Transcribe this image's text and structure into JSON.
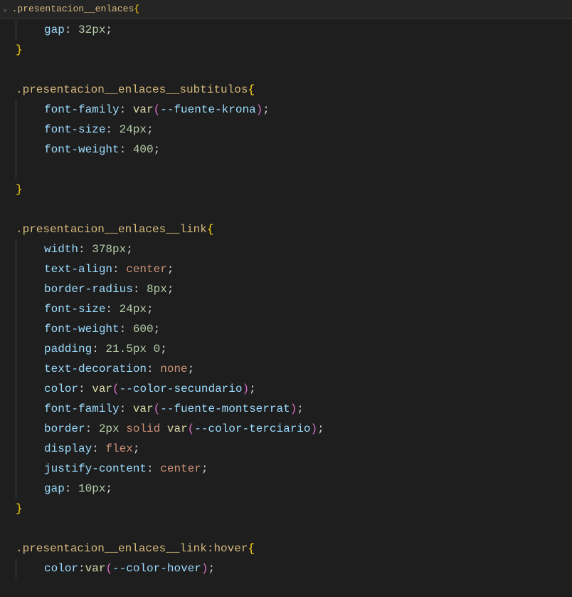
{
  "breadcrumb": {
    "selector": ".presentacion__enlaces"
  },
  "rules": [
    {
      "selector": ".presentacion__enlaces",
      "open_brace": "{",
      "decls": [
        {
          "prop": "gap",
          "value_num": "32px"
        }
      ],
      "close_brace": "}"
    },
    {
      "selector": ".presentacion__enlaces__subtitulos",
      "open_brace": "{",
      "decls": [
        {
          "prop": "font-family",
          "value_func": "var",
          "value_var": "--fuente-krona"
        },
        {
          "prop": "font-size",
          "value_num": "24px"
        },
        {
          "prop": "font-weight",
          "value_num": "400"
        }
      ],
      "trailing_blank": true,
      "close_brace": "}"
    },
    {
      "selector": ".presentacion__enlaces__link",
      "open_brace": "{",
      "decls": [
        {
          "prop": "width",
          "value_num": "378px"
        },
        {
          "prop": "text-align",
          "value_kw": "center"
        },
        {
          "prop": "border-radius",
          "value_num": "8px"
        },
        {
          "prop": "font-size",
          "value_num": "24px"
        },
        {
          "prop": "font-weight",
          "value_num": "600"
        },
        {
          "prop": "padding",
          "value_num": "21.5px 0"
        },
        {
          "prop": "text-decoration",
          "value_kw": "none"
        },
        {
          "prop": "color",
          "value_func": "var",
          "value_var": "--color-secundario"
        },
        {
          "prop": "font-family",
          "value_func": "var",
          "value_var": "--fuente-montserrat"
        },
        {
          "prop": "border",
          "value_border_num": "2px",
          "value_border_kw": "solid",
          "value_func": "var",
          "value_var": "--color-terciario"
        },
        {
          "prop": "display",
          "value_kw": "flex"
        },
        {
          "prop": "justify-content",
          "value_kw": "center"
        },
        {
          "prop": "gap",
          "value_num": "10px"
        }
      ],
      "close_brace": "}"
    },
    {
      "selector": ".presentacion__enlaces__link",
      "pseudo": ":hover",
      "open_brace": "{",
      "decls": [
        {
          "prop": "color",
          "no_space": true,
          "value_func": "var",
          "value_var": "--color-hover"
        }
      ]
    }
  ]
}
